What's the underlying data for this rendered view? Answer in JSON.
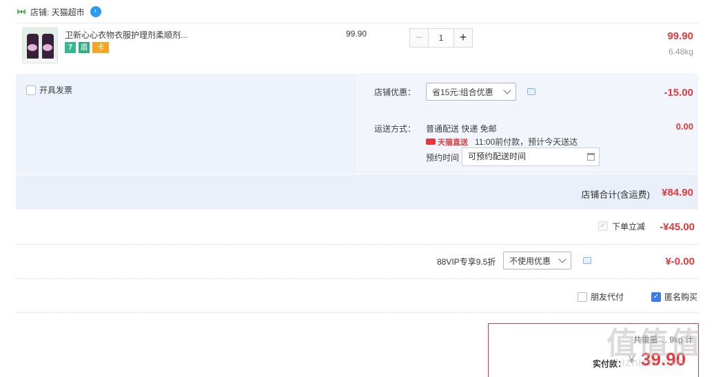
{
  "shop": {
    "label": "店铺: 天猫超市",
    "icon": "tmall-butterfly-icon",
    "chat_icon": "wangwang-icon"
  },
  "item": {
    "title": "卫新心心衣物衣服护理剂柔顺剂...",
    "unit_price": "99.90",
    "quantity": "1",
    "minus_label": "−",
    "plus_label": "+",
    "row_price": "99.90",
    "weight": "6.48kg",
    "badges": [
      "7",
      "盾",
      "卡"
    ]
  },
  "invoice": {
    "label": "开具发票"
  },
  "coupon": {
    "label": "店铺优惠：",
    "selected": "省15元:组合优惠",
    "amount": "-15.00"
  },
  "shipping": {
    "label": "运送方式：",
    "method": "普通配送 快递 免邮",
    "direct_label": "天猫直送",
    "direct_note": "11:00前付款，预计今天送达",
    "schedule_label": "预约时间",
    "schedule_placeholder": "可预约配送时间",
    "cost": "0.00"
  },
  "shop_total": {
    "label": "店铺合计(含运费)",
    "value": "¥84.90"
  },
  "order_discount": {
    "label": "下单立减",
    "value": "-¥45.00"
  },
  "vip": {
    "label": "88VIP专享9.5折",
    "selected": "不使用优惠",
    "value": "¥-0.00"
  },
  "options": {
    "friend_pay": "朋友代付",
    "anonymous": "匿名购买"
  },
  "payment": {
    "hint": "共重量 ... 9kg 计",
    "label": "实付款：",
    "currency": "¥",
    "value": "39.90"
  },
  "watermark": {
    "text": "值值值",
    "sub": "zhizhizhi.com"
  },
  "colors": {
    "accent": "#e4393c",
    "blue_bg": "#eef3fb",
    "check_blue": "#3d7ce8"
  }
}
